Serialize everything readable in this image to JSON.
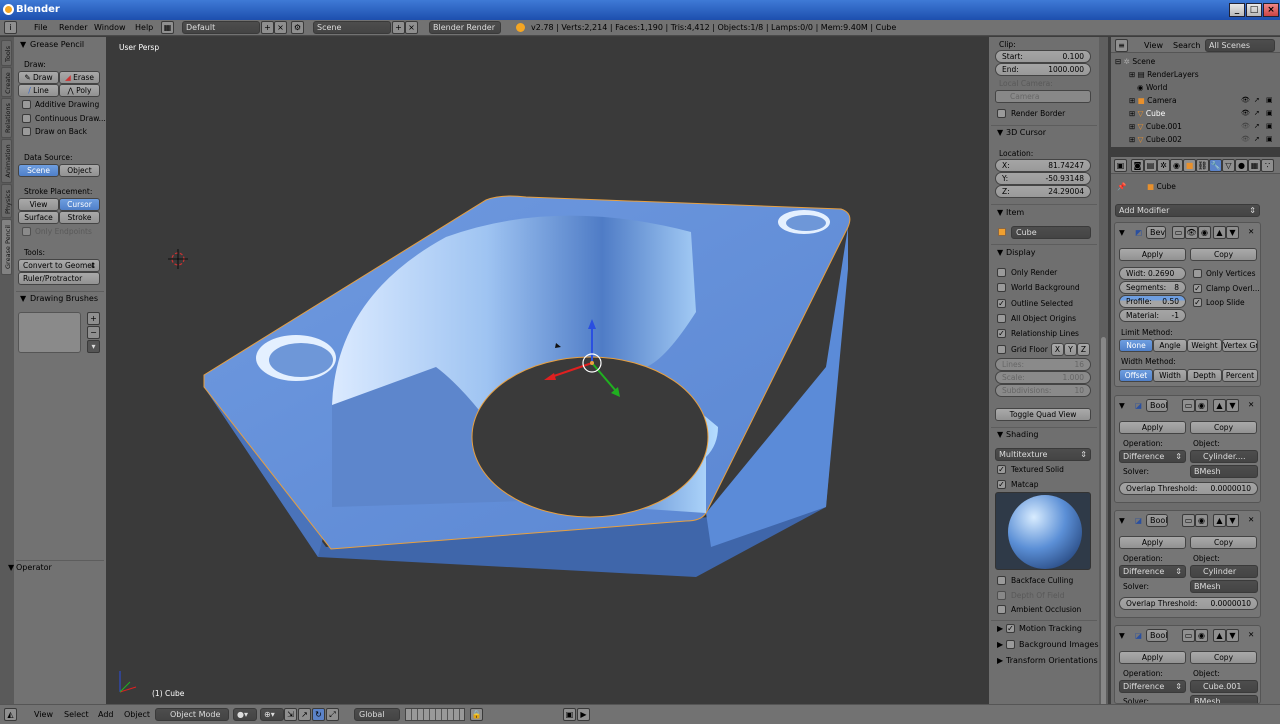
{
  "title": "Blender",
  "window_buttons": [
    "_",
    "□",
    "×"
  ],
  "menus": [
    "File",
    "Render",
    "Window",
    "Help"
  ],
  "layout": "Default",
  "scene": "Scene",
  "engine": "Blender Render",
  "stats": "v2.78 | Verts:2,214 | Faces:1,190 | Tris:4,412 | Objects:1/8 | Lamps:0/0 | Mem:9.40M | Cube",
  "left_tabs": [
    "Tools",
    "Create",
    "Relations",
    "Animation",
    "Physics",
    "Grease Pencil"
  ],
  "grease": {
    "header": "Grease Pencil",
    "draw_label": "Draw:",
    "draw": "Draw",
    "erase": "Erase",
    "line": "Line",
    "poly": "Poly",
    "additive": "Additive Drawing",
    "continuous": "Continuous Draw...",
    "draw_on_back": "Draw on Back",
    "data_source": "Data Source:",
    "scene": "Scene",
    "object": "Object",
    "stroke_placement": "Stroke Placement:",
    "view": "View",
    "cursor": "Cursor",
    "surface": "Surface",
    "stroke": "Stroke",
    "only_endpoints": "Only Endpoints",
    "tools": "Tools:",
    "convert": "Convert to Geomet",
    "ruler": "Ruler/Protractor",
    "brushes": "Drawing Brushes"
  },
  "operator": "Operator",
  "viewport": {
    "label": "User Persp",
    "object_label": "(1) Cube"
  },
  "props": {
    "clip": "Clip:",
    "start_l": "Start:",
    "start_v": "0.100",
    "end_l": "End:",
    "end_v": "1000.000",
    "local_camera": "Local Camera:",
    "camera": "Camera",
    "render_border": "Render Border",
    "cursor_header": "3D Cursor",
    "location": "Location:",
    "x_l": "X:",
    "x_v": "81.74247",
    "y_l": "Y:",
    "y_v": "-50.93148",
    "z_l": "Z:",
    "z_v": "24.29004",
    "item_header": "Item",
    "item_name": "Cube",
    "display_header": "Display",
    "only_render": "Only Render",
    "world_bg": "World Background",
    "outline_selected": "Outline Selected",
    "all_origins": "All Object Origins",
    "relationship": "Relationship Lines",
    "grid_floor": "Grid Floor",
    "gx": "X",
    "gy": "Y",
    "gz": "Z",
    "lines_l": "Lines:",
    "lines_v": "16",
    "scale_l": "Scale:",
    "scale_v": "1.000",
    "subdiv_l": "Subdivisions:",
    "subdiv_v": "10",
    "toggle_quad": "Toggle Quad View",
    "shading_header": "Shading",
    "shading_mode": "Multitexture",
    "textured_solid": "Textured Solid",
    "matcap": "Matcap",
    "backface": "Backface Culling",
    "dof": "Depth Of Field",
    "ao": "Ambient Occlusion",
    "motion": "Motion Tracking",
    "bg_images": "Background Images",
    "transform": "Transform Orientations"
  },
  "outliner": {
    "view": "View",
    "search": "Search",
    "all_scenes": "All Scenes",
    "items": [
      "Scene",
      "RenderLayers",
      "World",
      "Camera",
      "Cube",
      "Cube.001",
      "Cube.002"
    ]
  },
  "modifiers": {
    "object_name": "Cube",
    "add_modifier": "Add Modifier",
    "bevel": {
      "name": "Bev",
      "apply": "Apply",
      "copy": "Copy",
      "width_l": "Widt:",
      "width_v": "0.2690",
      "segments_l": "Segments:",
      "segments_v": "8",
      "profile_l": "Profile:",
      "profile_v": "0.50",
      "material_l": "Material:",
      "material_v": "-1",
      "only_vertices": "Only Vertices",
      "clamp": "Clamp Overl...",
      "loop_slide": "Loop Slide",
      "limit_method": "Limit Method:",
      "limits": [
        "None",
        "Angle",
        "Weight",
        "Vertex Gr"
      ],
      "width_method": "Width Method:",
      "widths": [
        "Offset",
        "Width",
        "Depth",
        "Percent"
      ]
    },
    "bools": [
      {
        "name": "Bool",
        "object": "Cylinder....",
        "threshold": "0.0000010"
      },
      {
        "name": "Bool",
        "object": "Cylinder",
        "threshold": "0.0000010"
      },
      {
        "name": "Bool",
        "object": "Cube.001",
        "threshold": ""
      }
    ],
    "apply": "Apply",
    "copy": "Copy",
    "operation": "Operation:",
    "object": "Object:",
    "difference": "Difference",
    "solver": "Solver:",
    "bmesh": "BMesh",
    "overlap": "Overlap Threshold:"
  },
  "bottom": {
    "view": "View",
    "select": "Select",
    "add": "Add",
    "object": "Object",
    "mode": "Object Mode",
    "orientation": "Global"
  }
}
